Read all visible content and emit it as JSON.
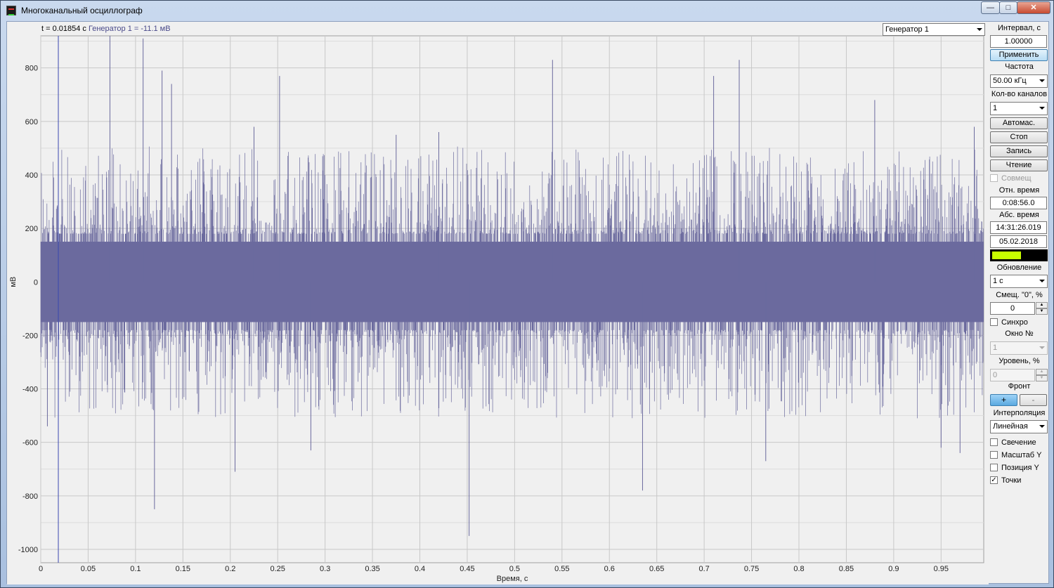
{
  "window": {
    "title": "Многоканальный осциллограф"
  },
  "readout": {
    "time_text": "t = 0.01854 с",
    "channel_text": "Генератор 1 = -11.1 мВ"
  },
  "channel_select": {
    "value": "Генератор 1"
  },
  "panel": {
    "interval_label": "Интервал, с",
    "interval_value": "1.00000",
    "apply_button": "Применить",
    "freq_label": "Частота",
    "freq_value": "50.00 кГц",
    "channels_label": "Кол-во каналов",
    "channels_value": "1",
    "auto_scale_button": "Автомас.",
    "stop_button": "Стоп",
    "record_button": "Запись",
    "read_button": "Чтение",
    "combine_label": "Совмещ",
    "rel_time_label": "Отн. время",
    "rel_time_value": "0:08:56.0",
    "abs_time_label": "Абс. время",
    "abs_time_value": "14:31:26.019",
    "date_value": "05.02.2018",
    "buffer_level": 0.55,
    "update_label": "Обновление",
    "update_value": "1 с",
    "offset_label": "Смещ. \"0\", %",
    "offset_value": "0",
    "sync_label": "Синхро",
    "window_no_label": "Окно №",
    "window_no_value": "1",
    "level_label": "Уровень, %",
    "level_value": "0",
    "front_label": "Фронт",
    "front_plus": "+",
    "front_minus": "-",
    "interp_label": "Интерполяция",
    "interp_value": "Линейная",
    "glow_label": "Свечение",
    "scale_y_label": "Масштаб Y",
    "pos_y_label": "Позиция Y",
    "points_label": "Точки",
    "points_mark": "✓"
  },
  "colors": {
    "signal": "#6b6a9e",
    "cursor": "#3a48b0",
    "indicator": "#c8ff00"
  },
  "chart_data": {
    "type": "line",
    "xlabel": "Время, с",
    "ylabel": "мВ",
    "xlim": [
      0,
      0.995
    ],
    "ylim": [
      -1050,
      920
    ],
    "x_ticks": [
      0,
      0.05,
      0.1,
      0.15,
      0.2,
      0.25,
      0.3,
      0.35,
      0.4,
      0.45,
      0.5,
      0.55,
      0.6,
      0.65,
      0.7,
      0.75,
      0.8,
      0.85,
      0.9,
      0.95
    ],
    "x_tick_labels": [
      "0",
      "0.05",
      "0.1",
      "0.15",
      "0.2",
      "0.25",
      "0.3",
      "0.35",
      "0.4",
      "0.45",
      "0.5",
      "0.55",
      "0.6",
      "0.65",
      "0.7",
      "0.75",
      "0.8",
      "0.85",
      "0.9",
      "0.95"
    ],
    "y_ticks": [
      800,
      600,
      400,
      200,
      0,
      -200,
      -400,
      -600,
      -800,
      -1000
    ],
    "y_tick_labels": [
      "800",
      "600",
      "400",
      "200",
      "0",
      "-200",
      "-400",
      "-600",
      "-800",
      "-1000"
    ],
    "cursor_x": 0.01854,
    "series": [
      {
        "band_upper": 150,
        "band_lower": -150,
        "spikes": [
          {
            "x": 0.007,
            "y": -540
          },
          {
            "x": 0.073,
            "y": 920
          },
          {
            "x": 0.108,
            "y": 910
          },
          {
            "x": 0.12,
            "y": -850
          },
          {
            "x": 0.128,
            "y": 790
          },
          {
            "x": 0.138,
            "y": 740
          },
          {
            "x": 0.205,
            "y": -710
          },
          {
            "x": 0.225,
            "y": 580
          },
          {
            "x": 0.252,
            "y": 770
          },
          {
            "x": 0.285,
            "y": -630
          },
          {
            "x": 0.375,
            "y": 550
          },
          {
            "x": 0.42,
            "y": 560
          },
          {
            "x": 0.452,
            "y": -950
          },
          {
            "x": 0.54,
            "y": 830
          },
          {
            "x": 0.635,
            "y": -780
          },
          {
            "x": 0.71,
            "y": 770
          },
          {
            "x": 0.737,
            "y": 830
          },
          {
            "x": 0.765,
            "y": -670
          },
          {
            "x": 0.88,
            "y": 680
          },
          {
            "x": 0.95,
            "y": -620
          },
          {
            "x": 0.97,
            "y": -640
          },
          {
            "x": 0.985,
            "y": 580
          }
        ]
      }
    ]
  }
}
